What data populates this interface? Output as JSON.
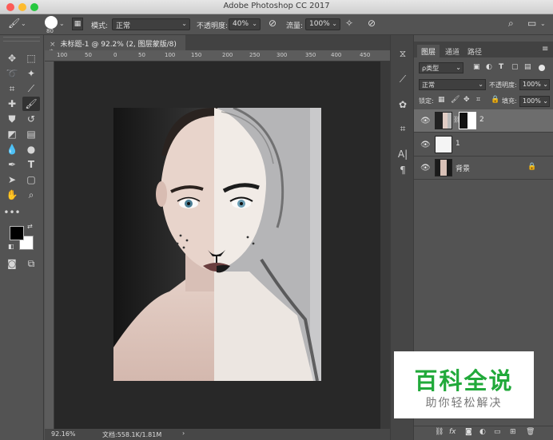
{
  "app": {
    "title": "Adobe Photoshop CC 2017"
  },
  "options": {
    "brush_size": "80",
    "mode_label": "模式:",
    "mode_value": "正常",
    "opacity_label": "不透明度:",
    "opacity_value": "40%",
    "flow_label": "流量:",
    "flow_value": "100%"
  },
  "document": {
    "tab_title": "未标题-1 @ 92.2% (2, 图层蒙版/8) *",
    "ruler_labels": [
      "100",
      "50",
      "0",
      "50",
      "100",
      "150",
      "200",
      "250",
      "300",
      "350",
      "400",
      "450"
    ]
  },
  "status": {
    "zoom": "92.16%",
    "doc_size": "文档:558.1K/1.81M"
  },
  "panel": {
    "tabs": [
      "图层",
      "通道",
      "路径"
    ],
    "kind_filter": "ρ类型",
    "blend_mode": "正常",
    "opacity_label": "不透明度:",
    "opacity_value": "100%",
    "lock_label": "锁定:",
    "fill_label": "填充:",
    "fill_value": "100%",
    "layers": [
      {
        "name": "2",
        "selected": true,
        "has_mask": true
      },
      {
        "name": "1",
        "selected": false,
        "has_mask": false
      },
      {
        "name": "背景",
        "selected": false,
        "has_mask": false,
        "locked": true
      }
    ]
  },
  "watermark": {
    "title": "百科全说",
    "subtitle": "助你轻松解决"
  },
  "colors": {
    "accent_green": "#21a93a",
    "selection": "#6d6d6d"
  }
}
